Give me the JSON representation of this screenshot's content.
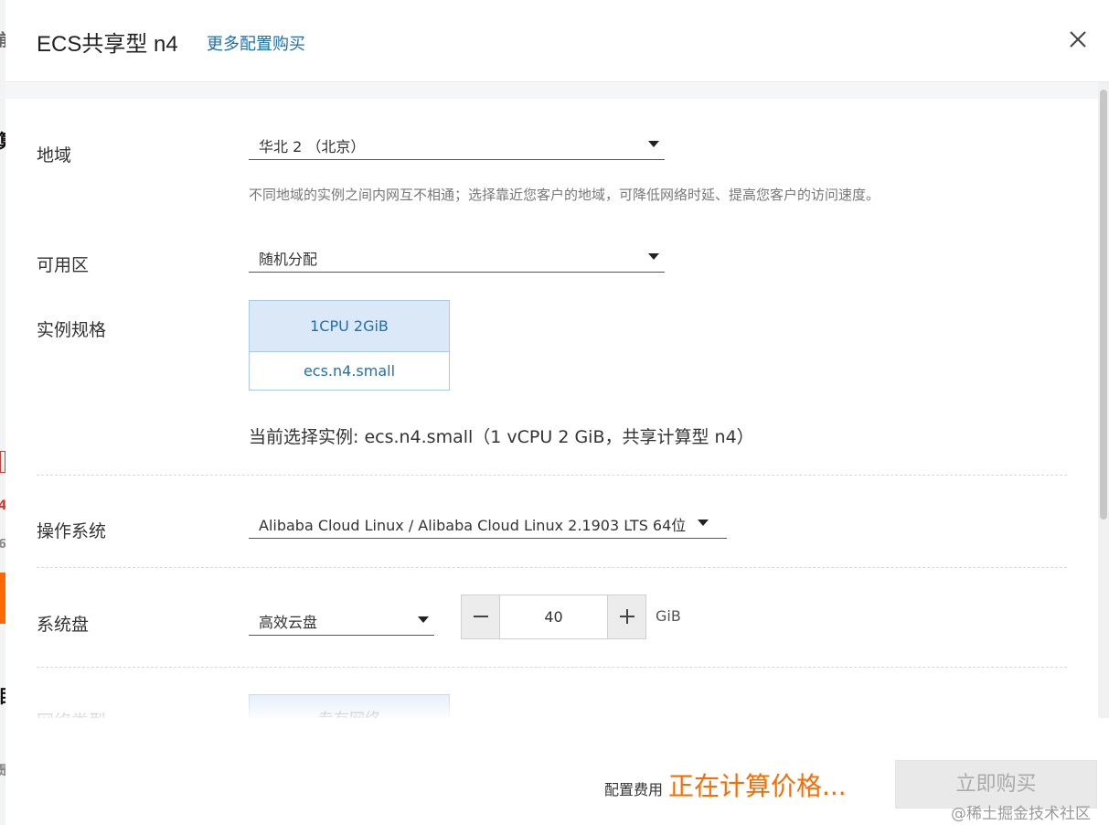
{
  "header": {
    "title": "ECS共享型 n4",
    "more_config_link": "更多配置购买"
  },
  "region": {
    "label": "地域",
    "value": "华北 2 （北京）",
    "hint": "不同地域的实例之间内网互不相通；选择靠近您客户的地域，可降低网络时延、提高您客户的访问速度。"
  },
  "zone": {
    "label": "可用区",
    "value": "随机分配"
  },
  "instance": {
    "label": "实例规格",
    "spec_primary": "1CPU 2GiB",
    "spec_secondary": "ecs.n4.small",
    "current_selection": "当前选择实例: ecs.n4.small（1 vCPU 2 GiB，共享计算型 n4）"
  },
  "os": {
    "label": "操作系统",
    "value": "Alibaba Cloud Linux / Alibaba Cloud Linux 2.1903 LTS 64位"
  },
  "disk": {
    "label": "系统盘",
    "type_value": "高效云盘",
    "size_value": "40",
    "unit": "GiB"
  },
  "network": {
    "label": "网络类型",
    "option": "专有网络"
  },
  "footer": {
    "fee_label": "配置费用",
    "fee_value": "正在计算价格...",
    "buy_button": "立即购买"
  },
  "watermark": "@稀土掘金技术社区",
  "colors": {
    "link": "#1f6fb5",
    "accent": "#ff6a00",
    "selected_bg": "#dbe8f7",
    "selected_border": "#a9c9ec"
  },
  "background_page_marks": [
    "前",
    "算",
    "4",
    "6",
    "目",
    "是"
  ]
}
